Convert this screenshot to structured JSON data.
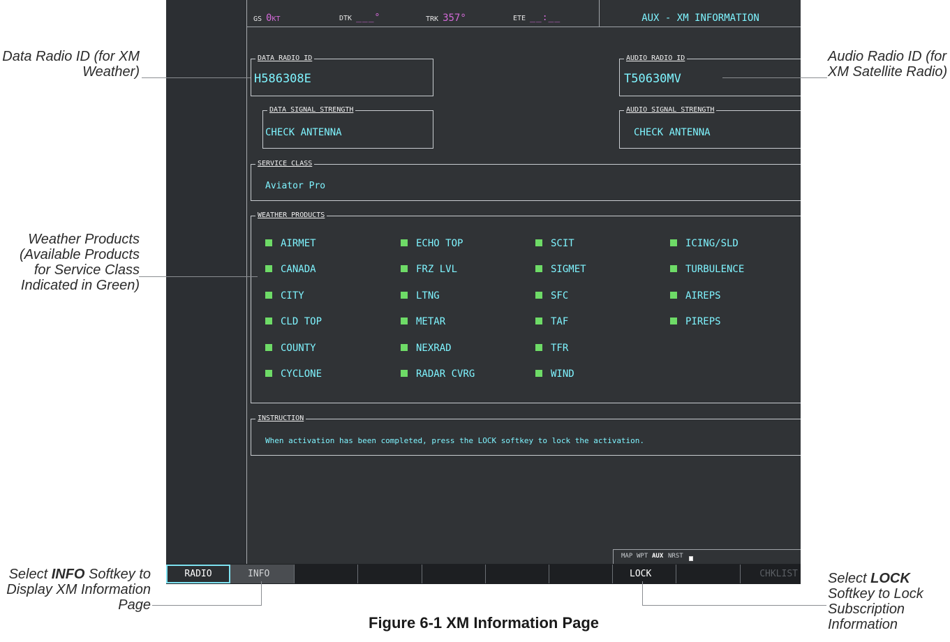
{
  "topbar": {
    "gs_label": "GS",
    "gs_value": "0",
    "gs_unit": "KT",
    "dtk_label": "DTK",
    "dtk_value": "___°",
    "trk_label": "TRK",
    "trk_value": "357°",
    "ete_label": "ETE",
    "ete_value": "__:__",
    "page_title": "AUX - XM INFORMATION"
  },
  "data_radio": {
    "label": "DATA RADIO ID",
    "value": "H586308E"
  },
  "audio_radio": {
    "label": "AUDIO RADIO ID",
    "value": "T50630MV"
  },
  "data_signal": {
    "label": "DATA SIGNAL STRENGTH",
    "value": "CHECK ANTENNA"
  },
  "audio_signal": {
    "label": "AUDIO SIGNAL STRENGTH",
    "value": "CHECK ANTENNA"
  },
  "service_class": {
    "label": "SERVICE CLASS",
    "value": "Aviator Pro"
  },
  "weather_products": {
    "label": "WEATHER PRODUCTS",
    "indicator_color": "#6edb67",
    "columns": [
      [
        "AIRMET",
        "CANADA",
        "CITY",
        "CLD TOP",
        "COUNTY",
        "CYCLONE"
      ],
      [
        "ECHO TOP",
        "FRZ LVL",
        "LTNG",
        "METAR",
        "NEXRAD",
        "RADAR CVRG"
      ],
      [
        "SCIT",
        "SIGMET",
        "SFC",
        "TAF",
        "TFR",
        "WIND"
      ],
      [
        "ICING/SLD",
        "TURBULENCE",
        "AIREPS",
        "PIREPS"
      ]
    ]
  },
  "instruction": {
    "label": "INSTRUCTION",
    "text": "When activation has been completed, press the LOCK softkey to lock the activation."
  },
  "page_group": {
    "groups": [
      "MAP",
      "WPT",
      "AUX",
      "NRST"
    ],
    "active_group": "AUX",
    "page_dots_total": 6,
    "page_dots_active": 5
  },
  "softkeys": [
    "RADIO",
    "INFO",
    "",
    "",
    "",
    "",
    "",
    "LOCK",
    "",
    "CHKLIST"
  ],
  "callouts": {
    "data_radio": "Data Radio ID (for XM Weather)",
    "audio_radio": "Audio Radio ID (for XM Satellite Radio)",
    "weather": "Weather Products (Available Products for Service Class Indicated in Green)",
    "info_prefix": "Select ",
    "info_key": "INFO",
    "info_suffix": " Softkey to Display XM Information Page",
    "lock_prefix": "Select ",
    "lock_key": "LOCK",
    "lock_suffix": " Softkey to Lock Subscription Information"
  },
  "caption": "Figure 6-1  XM Information Page",
  "colors": {
    "screen_bg": "#303336",
    "cyan_text": "#7ff4ff",
    "magenta_text": "#d36ad8",
    "available_green": "#6edb67"
  }
}
